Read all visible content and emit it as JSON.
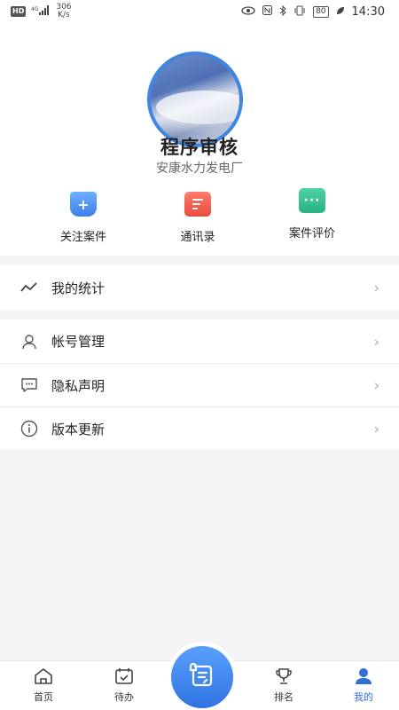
{
  "status_bar": {
    "hd": "HD",
    "network": "4G",
    "speed_value": "306",
    "speed_unit": "K/s",
    "battery": "80",
    "time": "14:30"
  },
  "profile": {
    "name": "程序审核",
    "organization": "安康水力发电厂"
  },
  "quick_actions": [
    {
      "label": "关注案件",
      "icon": "bookmark-plus-icon",
      "color": "#3d7fe6"
    },
    {
      "label": "通讯录",
      "icon": "contacts-book-icon",
      "color": "#e84a3e"
    },
    {
      "label": "案件评价",
      "icon": "chat-dots-icon",
      "color": "#27b184"
    }
  ],
  "menu": {
    "stats": {
      "label": "我的统计",
      "icon": "trend-line-icon"
    },
    "settings": [
      {
        "label": "帐号管理",
        "icon": "user-icon"
      },
      {
        "label": "隐私声明",
        "icon": "message-icon"
      },
      {
        "label": "版本更新",
        "icon": "info-icon"
      }
    ],
    "arrow": "›"
  },
  "tabbar": {
    "home": "首页",
    "todo": "待办",
    "rank": "排名",
    "mine": "我的",
    "active": "mine",
    "active_color": "#2f6fd8"
  }
}
